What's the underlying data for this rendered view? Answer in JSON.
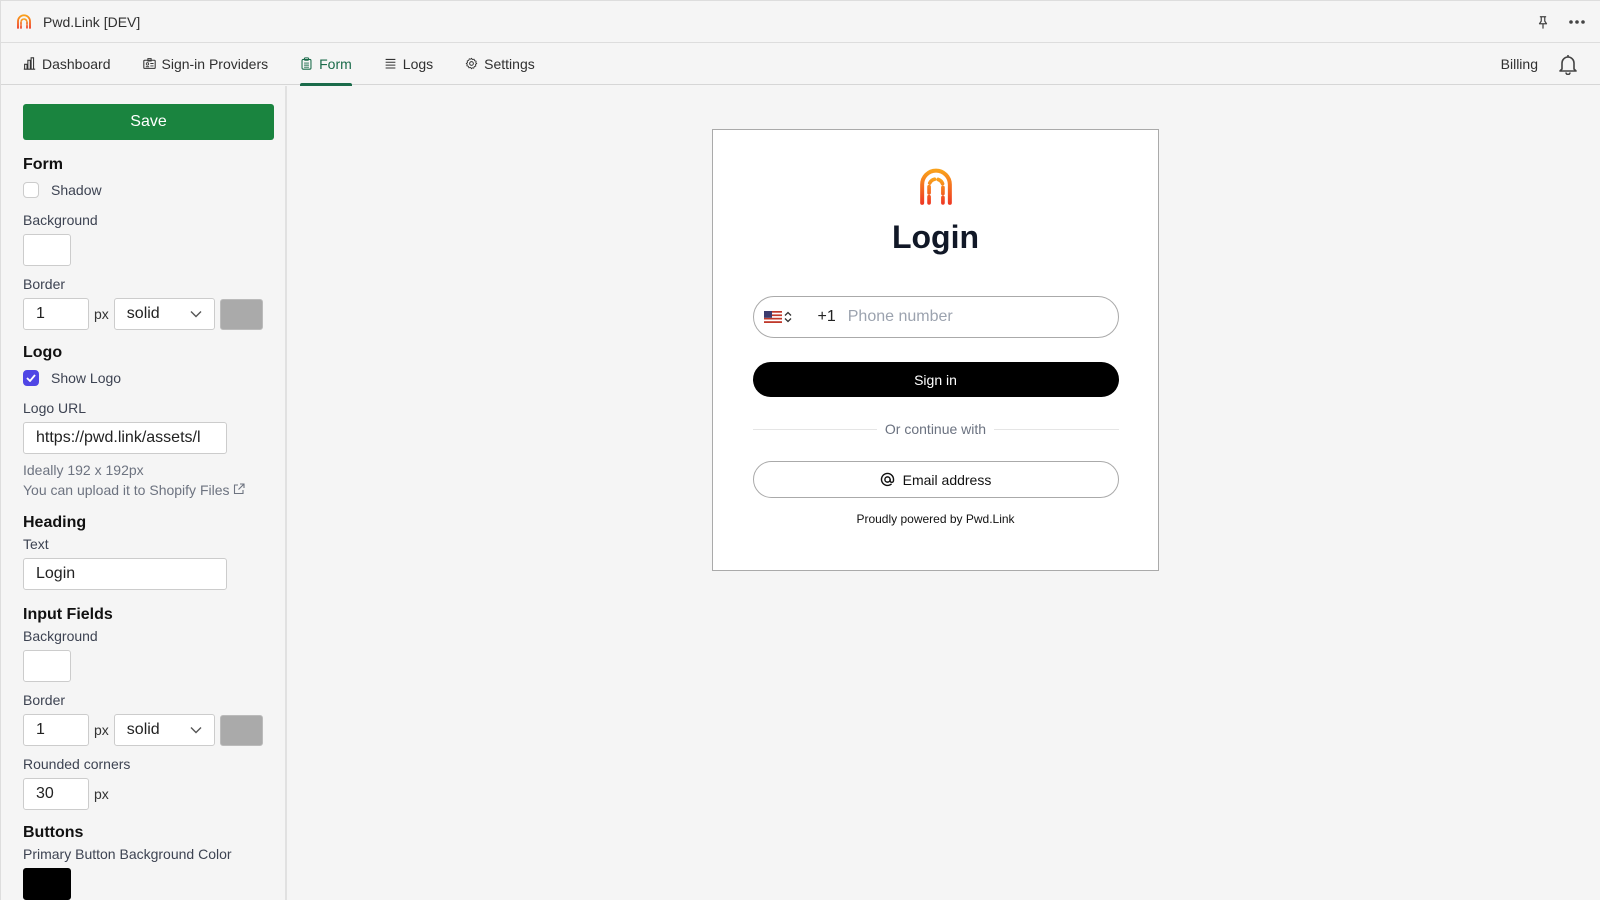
{
  "app": {
    "title": "Pwd.Link [DEV]"
  },
  "nav": {
    "tabs": [
      {
        "label": "Dashboard",
        "icon": "bar-chart-icon",
        "active": false
      },
      {
        "label": "Sign-in Providers",
        "icon": "id-card-icon",
        "active": false
      },
      {
        "label": "Form",
        "icon": "clipboard-icon",
        "active": true
      },
      {
        "label": "Logs",
        "icon": "list-icon",
        "active": false
      },
      {
        "label": "Settings",
        "icon": "gear-icon",
        "active": false
      }
    ],
    "billing_label": "Billing"
  },
  "sidebar": {
    "save_label": "Save",
    "form": {
      "title": "Form",
      "shadow_label": "Shadow",
      "shadow_checked": false,
      "background_label": "Background",
      "background_color": "#ffffff",
      "border_label": "Border",
      "border_width": "1",
      "border_unit": "px",
      "border_style": "solid",
      "border_color": "#aaaaaa"
    },
    "logo": {
      "title": "Logo",
      "show_logo_label": "Show Logo",
      "show_logo_checked": true,
      "url_label": "Logo URL",
      "url_value": "https://pwd.link/assets/l",
      "hint_size": "Ideally 192 x 192px",
      "hint_upload": "You can upload it to Shopify Files"
    },
    "heading": {
      "title": "Heading",
      "text_label": "Text",
      "text_value": "Login"
    },
    "input_fields": {
      "title": "Input Fields",
      "background_label": "Background",
      "background_color": "#ffffff",
      "border_label": "Border",
      "border_width": "1",
      "border_unit": "px",
      "border_style": "solid",
      "border_color": "#aaaaaa",
      "rounded_label": "Rounded corners",
      "rounded_value": "30",
      "rounded_unit": "px"
    },
    "buttons": {
      "title": "Buttons",
      "primary_bg_label": "Primary Button Background Color",
      "primary_bg_color": "#000000"
    }
  },
  "preview": {
    "heading": "Login",
    "phone_code": "+1",
    "phone_placeholder": "Phone number",
    "signin_label": "Sign in",
    "divider_text": "Or continue with",
    "email_label": "Email address",
    "powered_by": "Proudly powered by Pwd.Link"
  },
  "colors": {
    "accent": "#1a6b4a",
    "save": "#1a843f",
    "checkbox": "#5046e5"
  }
}
